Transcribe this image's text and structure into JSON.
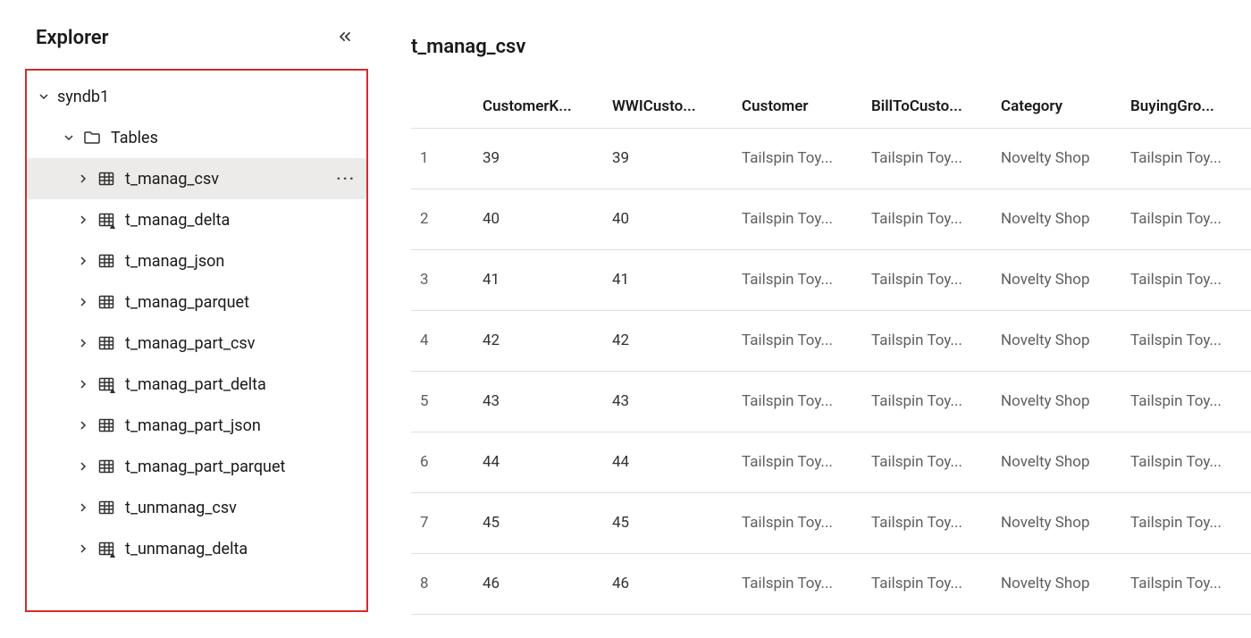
{
  "explorer": {
    "title": "Explorer",
    "database": "syndb1",
    "tables_label": "Tables",
    "more_label": "···",
    "items": [
      {
        "label": "t_manag_csv",
        "selected": true,
        "delta": false
      },
      {
        "label": "t_manag_delta",
        "selected": false,
        "delta": true
      },
      {
        "label": "t_manag_json",
        "selected": false,
        "delta": false
      },
      {
        "label": "t_manag_parquet",
        "selected": false,
        "delta": false
      },
      {
        "label": "t_manag_part_csv",
        "selected": false,
        "delta": false
      },
      {
        "label": "t_manag_part_delta",
        "selected": false,
        "delta": true
      },
      {
        "label": "t_manag_part_json",
        "selected": false,
        "delta": false
      },
      {
        "label": "t_manag_part_parquet",
        "selected": false,
        "delta": false
      },
      {
        "label": "t_unmanag_csv",
        "selected": false,
        "delta": false
      },
      {
        "label": "t_unmanag_delta",
        "selected": false,
        "delta": true
      }
    ]
  },
  "main": {
    "title": "t_manag_csv",
    "columns": [
      "CustomerK...",
      "WWICusto...",
      "Customer",
      "BillToCusto...",
      "Category",
      "BuyingGro..."
    ],
    "rows": [
      {
        "n": "1",
        "cells": [
          "39",
          "39",
          "Tailspin Toy...",
          "Tailspin Toy...",
          "Novelty Shop",
          "Tailspin Toy..."
        ]
      },
      {
        "n": "2",
        "cells": [
          "40",
          "40",
          "Tailspin Toy...",
          "Tailspin Toy...",
          "Novelty Shop",
          "Tailspin Toy..."
        ]
      },
      {
        "n": "3",
        "cells": [
          "41",
          "41",
          "Tailspin Toy...",
          "Tailspin Toy...",
          "Novelty Shop",
          "Tailspin Toy..."
        ]
      },
      {
        "n": "4",
        "cells": [
          "42",
          "42",
          "Tailspin Toy...",
          "Tailspin Toy...",
          "Novelty Shop",
          "Tailspin Toy..."
        ]
      },
      {
        "n": "5",
        "cells": [
          "43",
          "43",
          "Tailspin Toy...",
          "Tailspin Toy...",
          "Novelty Shop",
          "Tailspin Toy..."
        ]
      },
      {
        "n": "6",
        "cells": [
          "44",
          "44",
          "Tailspin Toy...",
          "Tailspin Toy...",
          "Novelty Shop",
          "Tailspin Toy..."
        ]
      },
      {
        "n": "7",
        "cells": [
          "45",
          "45",
          "Tailspin Toy...",
          "Tailspin Toy...",
          "Novelty Shop",
          "Tailspin Toy..."
        ]
      },
      {
        "n": "8",
        "cells": [
          "46",
          "46",
          "Tailspin Toy...",
          "Tailspin Toy...",
          "Novelty Shop",
          "Tailspin Toy..."
        ]
      }
    ]
  }
}
